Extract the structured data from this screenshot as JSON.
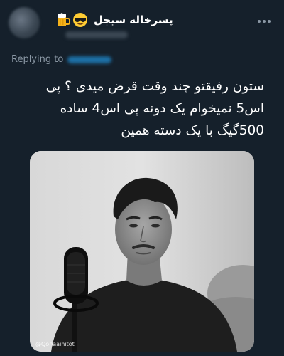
{
  "tweet": {
    "display_name": "پسرخاله سیجل",
    "emojis": [
      "beer-icon",
      "smiling-face-with-sunglasses-icon"
    ],
    "replying_to_label": "Replying to",
    "text": "ستون رفیقتو چند وقت قرض میدی ؟ پی اس5 نمیخوام یک دونه پی اس4 ساده 500گیگ با یک دسته همین",
    "media": {
      "watermark": "@Qonaaihitot",
      "style": "grayscale"
    }
  },
  "colors": {
    "background": "#15202b",
    "text_primary": "#ffffff",
    "text_secondary": "#8b98a5",
    "link": "#1d9bf0"
  }
}
